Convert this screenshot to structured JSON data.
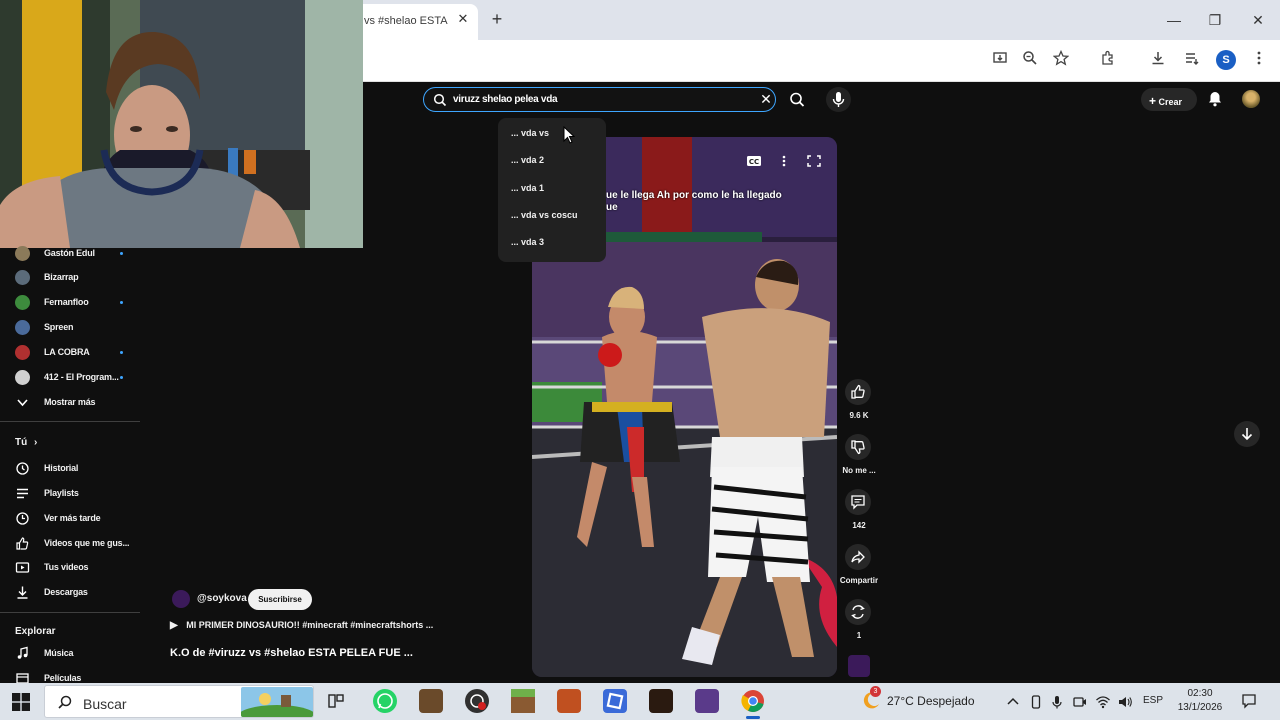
{
  "browser": {
    "tab_title": "vs #shelao ESTA",
    "tab_close": "✕",
    "new_tab": "+",
    "window_controls": {
      "minimize": "—",
      "restore": "❐",
      "close": "✕"
    },
    "toolbar_icons": [
      "install-app-icon",
      "zoom-icon",
      "star-icon",
      "extensions-icon",
      "download-icon",
      "reading-list-icon",
      "profile-icon",
      "menu-icon"
    ],
    "profile_initial": "S"
  },
  "youtube": {
    "search": {
      "query": "viruzz shelao pelea vda",
      "clear": "✕"
    },
    "create_label": "Crear",
    "suggestions": [
      "... vda vs",
      "... vda 2",
      "... vda 1",
      "... vda vs coscu",
      "... vda 3"
    ],
    "sidebar": {
      "subscriptions": [
        {
          "label": "Gastón Edul",
          "new": true,
          "color": "#8b7a5a"
        },
        {
          "label": "Bizarrap",
          "new": false,
          "color": "#5b6b7a"
        },
        {
          "label": "Fernanfloo",
          "new": true,
          "color": "#3d8b3d"
        },
        {
          "label": "Spreen",
          "new": false,
          "color": "#4a6a9a"
        },
        {
          "label": "LA COBRA",
          "new": true,
          "color": "#b03030"
        },
        {
          "label": "412 - El Program...",
          "new": true,
          "color": "#d0d0d0"
        }
      ],
      "show_more": "Mostrar más",
      "you_heading": "Tú",
      "you_chevron": "›",
      "you_items": [
        {
          "label": "Historial",
          "icon": "history-icon"
        },
        {
          "label": "Playlists",
          "icon": "playlists-icon"
        },
        {
          "label": "Ver más tarde",
          "icon": "watch-later-icon"
        },
        {
          "label": "Videos que me gus...",
          "icon": "liked-videos-icon"
        },
        {
          "label": "Tus videos",
          "icon": "your-videos-icon"
        },
        {
          "label": "Descargas",
          "icon": "downloads-icon"
        }
      ],
      "explore_heading": "Explorar",
      "explore_items": [
        {
          "label": "Música",
          "icon": "music-icon"
        },
        {
          "label": "Películas",
          "icon": "movies-icon"
        }
      ]
    },
    "video": {
      "caption_line1": "ue le llega Ah por como le ha llegado",
      "caption_line2": "ue",
      "channel": "@soykova",
      "subscribe_label": "Suscribirse",
      "playlist_text": "MI PRIMER DINOSAURIO!! #minecraft #minecraftshorts ...",
      "title": "K.O de #viruzz vs #shelao ESTA PELEA FUE ...",
      "likes": "9.6 K",
      "dislike_label": "No me ...",
      "comments": "142",
      "share_label": "Compartir",
      "remix_count": "1"
    }
  },
  "taskbar": {
    "search_label": "Buscar",
    "apps": [
      "task-view-icon",
      "whatsapp-icon",
      "game-icon-1",
      "obs-icon",
      "minecraft-icon",
      "game-icon-2",
      "roblox-icon",
      "fnaf-icon",
      "game-icon-3",
      "chrome-icon"
    ],
    "weather_badge": "3",
    "weather": "27°C  Despejado",
    "language": "ESP",
    "time": "02:30",
    "date": "13/1/2026"
  }
}
